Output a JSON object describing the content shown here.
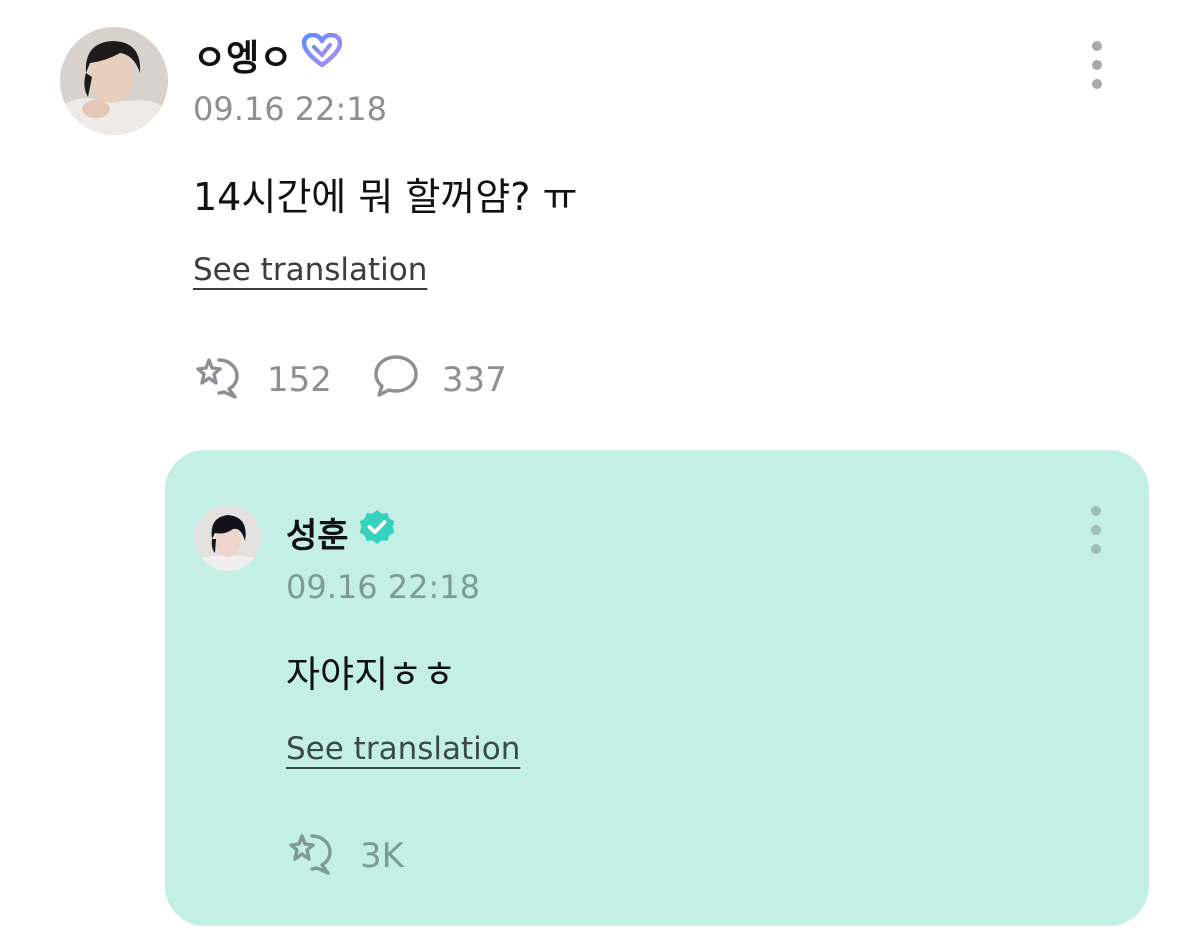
{
  "post": {
    "author": "ㅇ엥ㅇ",
    "author_badge_icon": "heart-membership-icon",
    "timestamp": "09.16 22:18",
    "body": "14시간에 뭐 할꺼얌? ㅠ",
    "translation_link": "See translation",
    "reactions_count": "152",
    "comments_count": "337",
    "more_icon": "kebab-menu-icon"
  },
  "reply": {
    "author": "성훈",
    "author_badge_icon": "verified-badge-icon",
    "timestamp": "09.16 22:18",
    "body": "자야지ㅎㅎ",
    "translation_link": "See translation",
    "reactions_count": "3K",
    "more_icon": "kebab-menu-icon"
  },
  "colors": {
    "reply_background": "#c3efe5",
    "timestamp_gray": "#8e8e93",
    "verified_teal": "#35d3bf",
    "membership_heart_gradient": [
      "#5b8cff",
      "#b48cff"
    ]
  }
}
